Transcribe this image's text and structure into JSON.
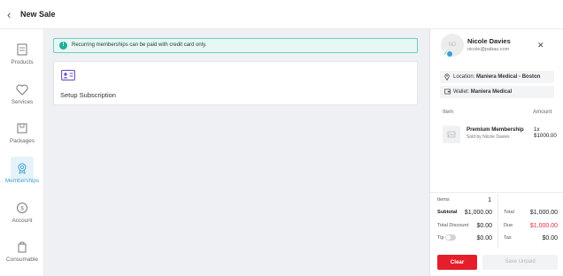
{
  "header": {
    "title": "New Sale"
  },
  "sidebar": {
    "items": [
      {
        "label": "Products",
        "icon": "products-icon"
      },
      {
        "label": "Services",
        "icon": "services-icon"
      },
      {
        "label": "Packages",
        "icon": "packages-icon"
      },
      {
        "label": "Memberships",
        "icon": "memberships-icon",
        "active": true
      },
      {
        "label": "Account",
        "icon": "account-icon"
      },
      {
        "label": "Consumable",
        "icon": "consumable-icon"
      }
    ]
  },
  "main": {
    "alert": "Recurring memberships can be paid with credit card only.",
    "card_label": "Setup Subscription"
  },
  "client": {
    "initials": "ND",
    "name": "Nicole Davies",
    "email": "nicole@pabau.com",
    "location_prefix": "Location:",
    "location": "Maniera Medical - Boston",
    "wallet_prefix": "Wallet:",
    "wallet": "Maniera Medical"
  },
  "cart": {
    "col_item": "Item",
    "col_amount": "Amount",
    "items": [
      {
        "name": "Premium Membership",
        "sold_by": "Sold by Nicole Davies",
        "qty_price": "1x $1000.00"
      }
    ]
  },
  "summary": {
    "items_label": "Items",
    "items_value": "1",
    "subtotal_label": "Subtotal",
    "subtotal_value": "$1,000.00",
    "discount_label": "Total Discount",
    "discount_value": "$0.00",
    "tip_label": "Tip",
    "tip_value": "$0.00",
    "total_label": "Total",
    "total_value": "$1,000.00",
    "due_label": "Due",
    "due_value": "$1,000.00",
    "tax_label": "Tax",
    "tax_value": "$0.00"
  },
  "actions": {
    "clear": "Clear",
    "save": "Save Unpaid"
  },
  "colors": {
    "accent": "#3b9dd4",
    "danger": "#e41e2b",
    "success": "#1fae96"
  }
}
